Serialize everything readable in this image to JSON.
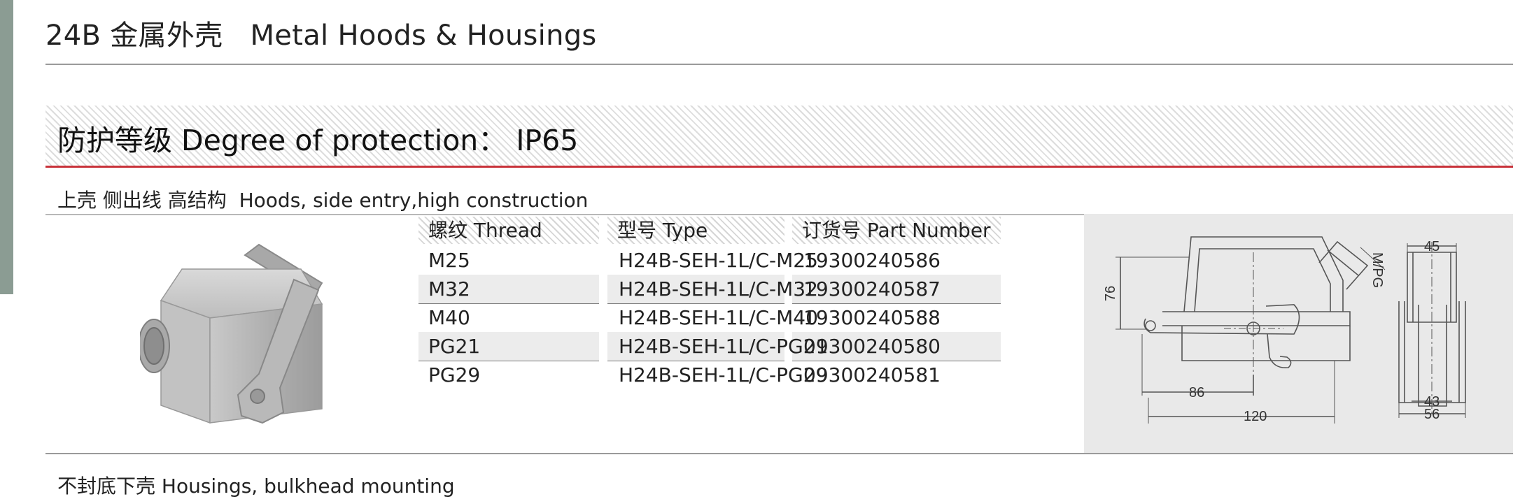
{
  "header": {
    "title": "24B 金属外壳   Metal Hoods & Housings"
  },
  "protection": {
    "text": "防护等级 Degree of protection： IP65"
  },
  "hoods_section": {
    "title": "上壳 侧出线 高结构  Hoods, side entry,high construction"
  },
  "table": {
    "headers": [
      "螺纹 Thread",
      "型号 Type",
      "订货号 Part Number"
    ],
    "rows": [
      {
        "thread": "M25",
        "type": "H24B-SEH-1L/C-M25",
        "part": "19300240586"
      },
      {
        "thread": "M32",
        "type": "H24B-SEH-1L/C-M32",
        "part": "19300240587"
      },
      {
        "thread": "M40",
        "type": "H24B-SEH-1L/C-M40",
        "part": "19300240588"
      },
      {
        "thread": "PG21",
        "type": "H24B-SEH-1L/C-PG21",
        "part": "09300240580"
      },
      {
        "thread": "PG29",
        "type": "H24B-SEH-1L/C-PG29",
        "part": "09300240581"
      }
    ]
  },
  "drawing": {
    "dim_76": "76",
    "dim_86": "86",
    "dim_120": "120",
    "dim_mpg": "M/PG",
    "dim_45": "45",
    "dim_43": "43",
    "dim_56": "56"
  },
  "bulkhead_section": {
    "title": "不封底下壳 Housings, bulkhead mounting"
  },
  "colors": {
    "accent_red": "#c8323a",
    "side_bar": "#8b9c93",
    "panel_gray": "#e9e9e9"
  }
}
